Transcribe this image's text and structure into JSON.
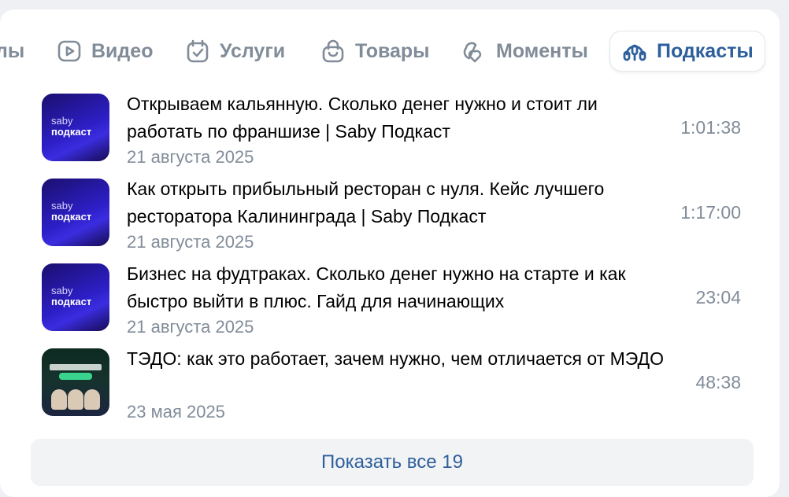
{
  "tabs": [
    {
      "label": "лы",
      "icon": "none"
    },
    {
      "label": "Видео",
      "icon": "play-icon"
    },
    {
      "label": "Услуги",
      "icon": "calendar-check-icon"
    },
    {
      "label": "Товары",
      "icon": "shopping-bag-icon"
    },
    {
      "label": "Моменты",
      "icon": "moments-icon"
    },
    {
      "label": "Подкасты",
      "icon": "podcast-icon",
      "active": true
    }
  ],
  "podcasts": [
    {
      "title": "Открываем кальянную. Сколько денег нужно и стоит ли работать по франшизе | Saby Подкаст",
      "date": "21 августа 2025",
      "duration": "1:01:38",
      "thumb_line1": "saby",
      "thumb_line2": "подкаст"
    },
    {
      "title": "Как открыть прибыльный ресторан с нуля. Кейс лучшего ресторатора Калининграда | Saby Подкаст",
      "date": "21 августа 2025",
      "duration": "1:17:00",
      "thumb_line1": "saby",
      "thumb_line2": "подкаст"
    },
    {
      "title": "Бизнес на фудтраках. Сколько денег нужно на старте и как быстро выйти в плюс. Гайд для начинающих",
      "date": "21 августа 2025",
      "duration": "23:04",
      "thumb_line1": "saby",
      "thumb_line2": "подкаст"
    },
    {
      "title": "ТЭДО: как это работает, зачем нужно, чем отличается от МЭДО",
      "date": "23 мая 2025",
      "duration": "48:38"
    }
  ],
  "show_all_label": "Показать все 19",
  "colors": {
    "accent": "#2d5f9c",
    "secondary": "#818c99"
  }
}
